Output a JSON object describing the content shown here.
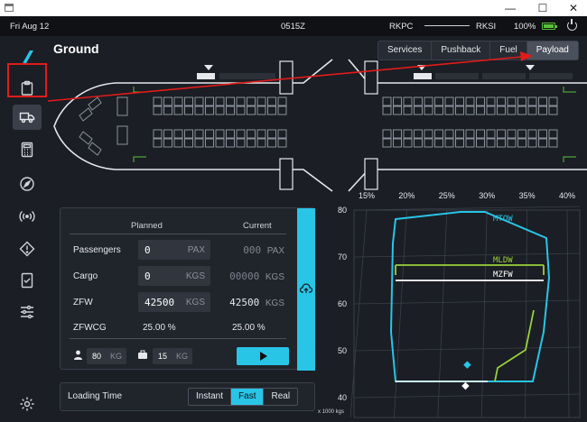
{
  "window": {
    "minimize": "—",
    "maximize": "☐",
    "close": "✕"
  },
  "status": {
    "date": "Fri Aug 12",
    "time": "0515Z",
    "origin": "RKPC",
    "destination": "RKSI",
    "battery": "100%"
  },
  "sidebar": {
    "items": [
      {
        "name": "logo",
        "icon": "tail-logo-icon"
      },
      {
        "name": "clipboard",
        "icon": "clipboard-icon"
      },
      {
        "name": "ground",
        "icon": "truck-icon",
        "active": true
      },
      {
        "name": "calculator",
        "icon": "calculator-icon"
      },
      {
        "name": "navigation",
        "icon": "compass-icon"
      },
      {
        "name": "atc",
        "icon": "broadcast-icon"
      },
      {
        "name": "failures",
        "icon": "warning-icon"
      },
      {
        "name": "checklist",
        "icon": "checklist-icon"
      },
      {
        "name": "settings-sliders",
        "icon": "sliders-icon"
      },
      {
        "name": "settings",
        "icon": "gear-icon"
      }
    ]
  },
  "page": {
    "title": "Ground"
  },
  "tabs": [
    {
      "label": "Services",
      "active": false
    },
    {
      "label": "Pushback",
      "active": false
    },
    {
      "label": "Fuel",
      "active": false
    },
    {
      "label": "Payload",
      "active": true
    }
  ],
  "payload": {
    "planned_header": "Planned",
    "current_header": "Current",
    "rows": {
      "passengers": {
        "label": "Passengers",
        "planned": "0",
        "planned_unit": "PAX",
        "current_dim": "000",
        "current_unit": "PAX"
      },
      "cargo": {
        "label": "Cargo",
        "planned": "0",
        "planned_unit": "KGS",
        "current_dim": "00000",
        "current_unit": "KGS"
      },
      "zfw": {
        "label": "ZFW",
        "planned": "42500",
        "planned_unit": "KGS",
        "current": "42500",
        "current_unit": "KGS"
      },
      "zfwcg": {
        "label": "ZFWCG",
        "planned": "25.00 %",
        "current": "25.00 %"
      }
    },
    "pax_weight": {
      "value": "80",
      "unit": "KG"
    },
    "bag_weight": {
      "value": "15",
      "unit": "KG"
    }
  },
  "loading_time": {
    "label": "Loading Time",
    "options": [
      "Instant",
      "Fast",
      "Real"
    ],
    "selected": "Fast"
  },
  "chart_data": {
    "type": "line",
    "title": "",
    "x_tick_labels": [
      "15%",
      "20%",
      "25%",
      "30%",
      "35%",
      "40%"
    ],
    "y_tick_labels": [
      "80",
      "70",
      "60",
      "50",
      "40"
    ],
    "xlim": [
      15,
      40
    ],
    "ylim": [
      40,
      80
    ],
    "y_unit_label": "x 1000 kgs",
    "limit_lines": [
      {
        "name": "MTOW",
        "color": "#29c5e6"
      },
      {
        "name": "MLDW",
        "color": "#9ad13b"
      },
      {
        "name": "MZFW",
        "color": "#ffffff"
      }
    ],
    "markers": [
      {
        "label": "ZFW",
        "cg": 25.0,
        "weight": 42.5,
        "color": "#ffffff"
      },
      {
        "label": "GW",
        "cg": 25.5,
        "weight": 47.0,
        "color": "#29c5e6"
      }
    ]
  }
}
